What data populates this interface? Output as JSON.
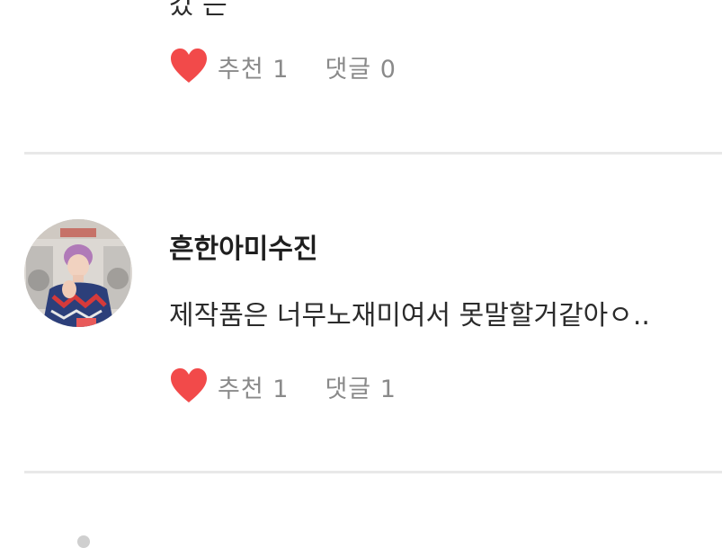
{
  "previous_comment": {
    "cut_text": "갔 는",
    "actions": {
      "like_icon": "heart-icon",
      "like_label": "추천",
      "like_count": "1",
      "comment_label": "댓글",
      "comment_count": "0"
    }
  },
  "comment": {
    "avatar": "avatar-photo",
    "author": "흔한아미수진",
    "text": "제작품은 너무노재미여서 못말할거같아ㅇ..",
    "actions": {
      "like_icon": "heart-icon",
      "like_label": "추천",
      "like_count": "1",
      "comment_label": "댓글",
      "comment_count": "1"
    }
  },
  "colors": {
    "heart": "#f24a4a",
    "action_text": "#8a8a8a",
    "divider": "#e8e8e8",
    "author": "#1e1e1e"
  }
}
